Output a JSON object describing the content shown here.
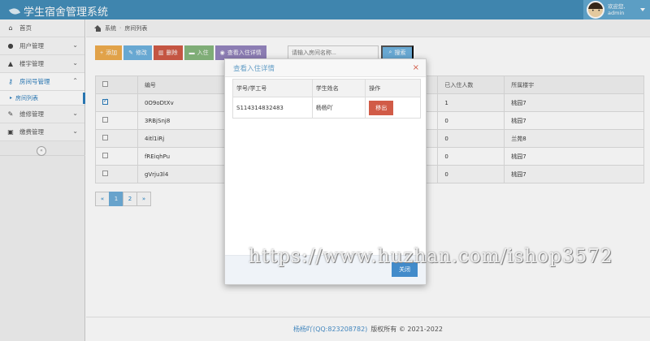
{
  "app": {
    "title": "学生宿舍管理系统"
  },
  "user": {
    "greeting": "欢迎您,",
    "name": "admin"
  },
  "sidebar": {
    "items": [
      {
        "label": "首页",
        "icon": "home-icon"
      },
      {
        "label": "用户管理",
        "icon": "user-icon"
      },
      {
        "label": "楼宇管理",
        "icon": "building-icon"
      },
      {
        "label": "房间号管理",
        "icon": "key-icon",
        "active": true
      },
      {
        "label": "维修管理",
        "icon": "wrench-icon"
      },
      {
        "label": "缴费管理",
        "icon": "money-icon"
      }
    ],
    "sub_item": "房间列表"
  },
  "breadcrumb": {
    "root": "系统",
    "current": "房间列表"
  },
  "toolbar": {
    "add": "添加",
    "edit": "修改",
    "delete": "删除",
    "checkin": "入住",
    "view": "查看入住详情",
    "search_placeholder": "请输入房间名称...",
    "search": "搜索"
  },
  "table": {
    "headers": [
      "编号",
      "已入住人数",
      "所属楼宇"
    ],
    "rows": [
      {
        "id": "0O9oDtXv",
        "count": "1",
        "building": "桃园7",
        "checked": true
      },
      {
        "id": "3RBjSnj8",
        "count": "0",
        "building": "桃园7",
        "checked": false
      },
      {
        "id": "4itl1iRj",
        "count": "0",
        "building": "兰苑8",
        "checked": false
      },
      {
        "id": "fREiqhPu",
        "count": "0",
        "building": "桃园7",
        "checked": false
      },
      {
        "id": "gVrju3l4",
        "count": "0",
        "building": "桃园7",
        "checked": false
      }
    ]
  },
  "pagination": {
    "prev": "«",
    "pages": [
      "1",
      "2"
    ],
    "next": "»",
    "current": "1"
  },
  "modal": {
    "title": "查看入住详情",
    "close_symbol": "×",
    "headers": [
      "学号/学工号",
      "学生姓名",
      "操作"
    ],
    "rows": [
      {
        "student_id": "S114314832483",
        "name": "杨杨吖",
        "action": "移出"
      }
    ],
    "close_button": "关闭"
  },
  "footer": {
    "author": "杨杨吖(QQ:823208782)",
    "copyright": "版权所有 © 2021-2022"
  },
  "watermark": "https://www.huzhan.com/ishop3572",
  "colors": {
    "navbar": "#438eb9",
    "accent": "#2b7dbc",
    "danger": "#d15b47",
    "primary": "#428bca"
  }
}
